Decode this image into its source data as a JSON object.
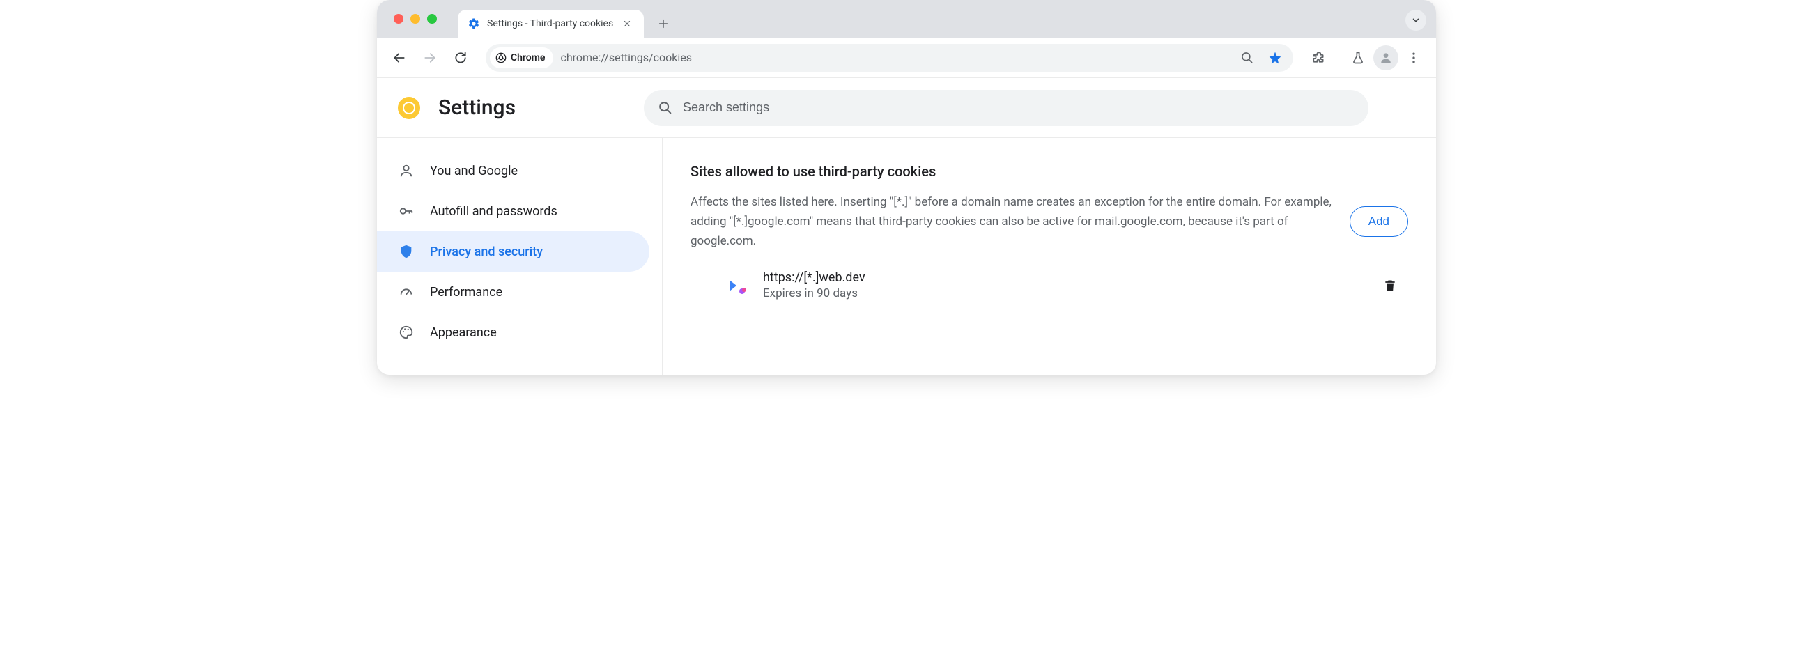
{
  "tab": {
    "title": "Settings - Third-party cookies"
  },
  "omnibox": {
    "chip_label": "Chrome",
    "url": "chrome://settings/cookies"
  },
  "header": {
    "title": "Settings",
    "search_placeholder": "Search settings"
  },
  "sidebar": {
    "items": [
      {
        "label": "You and Google"
      },
      {
        "label": "Autofill and passwords"
      },
      {
        "label": "Privacy and security"
      },
      {
        "label": "Performance"
      },
      {
        "label": "Appearance"
      }
    ]
  },
  "section": {
    "title": "Sites allowed to use third-party cookies",
    "description": "Affects the sites listed here. Inserting \"[*.]\" before a domain name creates an exception for the entire domain. For example, adding \"[*.]google.com\" means that third-party cookies can also be active for mail.google.com, because it's part of google.com.",
    "add_label": "Add",
    "site": {
      "url": "https://[*.]web.dev",
      "expires": "Expires in 90 days"
    }
  }
}
